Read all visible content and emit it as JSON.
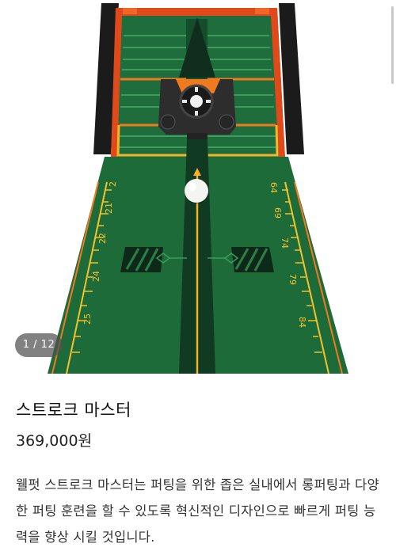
{
  "gallery": {
    "counter": "1 / 12",
    "image_alt": "golf-putting-mat-photo",
    "colors": {
      "mat_green": "#1f6b3b",
      "frame_black": "#1c1c1c",
      "orange": "#f07a1e",
      "yellow": "#ffd23c"
    },
    "ruler_left": [
      "2",
      "21",
      "22",
      "24",
      "25"
    ],
    "ruler_right": [
      "64",
      "69",
      "74",
      "79",
      "84"
    ]
  },
  "product": {
    "title": "스트로크 마스터",
    "price": "369,000원",
    "description": "웰펏 스트로크 마스터는 퍼팅을 위한 좁은 실내에서 롱퍼팅과 다양한 퍼팅 훈련을 할 수 있도록 혁신적인 디자인으로 빠르게 퍼팅 능력을 향상 시킬 것입니다."
  }
}
